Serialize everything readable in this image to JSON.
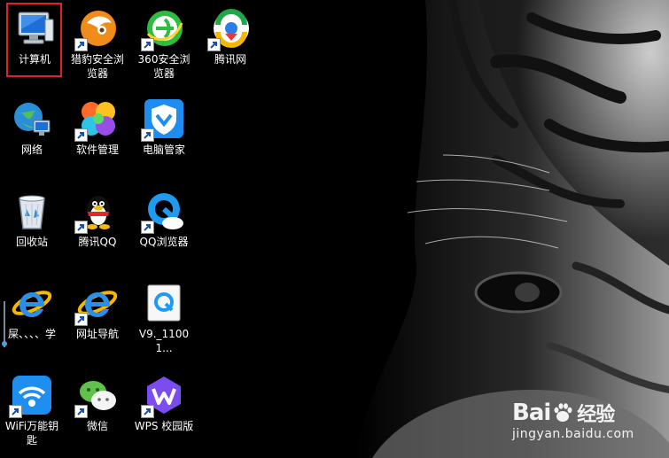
{
  "desktop": {
    "icons": [
      {
        "label": "计算机",
        "name": "computer-icon"
      },
      {
        "label": "猎豹安全浏览器",
        "name": "liebao-browser-icon"
      },
      {
        "label": "360安全浏览器",
        "name": "360-browser-icon"
      },
      {
        "label": "腾讯网",
        "name": "tencent-news-icon"
      },
      {
        "label": "网络",
        "name": "network-icon"
      },
      {
        "label": "软件管理",
        "name": "software-manager-icon"
      },
      {
        "label": "电脑管家",
        "name": "pc-manager-icon"
      },
      {
        "label": "回收站",
        "name": "recycle-bin-icon"
      },
      {
        "label": "腾讯QQ",
        "name": "qq-penguin-icon"
      },
      {
        "label": "QQ浏览器",
        "name": "qq-browser-icon"
      },
      {
        "label": "屎、、、、学",
        "name": "ie-icon"
      },
      {
        "label": "网址导航",
        "name": "ie-icon"
      },
      {
        "label": "V9._11001...",
        "name": "document-icon"
      },
      {
        "label": "WiFi万能钥匙",
        "name": "wifi-key-icon"
      },
      {
        "label": "微信",
        "name": "wechat-icon"
      },
      {
        "label": "WPS 校园版",
        "name": "wps-icon"
      }
    ]
  },
  "watermark": {
    "brand_left": "Bai",
    "brand_right": "经验",
    "url": "jingyan.baidu.com"
  },
  "colors": {
    "selection": "#e3202a",
    "background": "#000000"
  }
}
